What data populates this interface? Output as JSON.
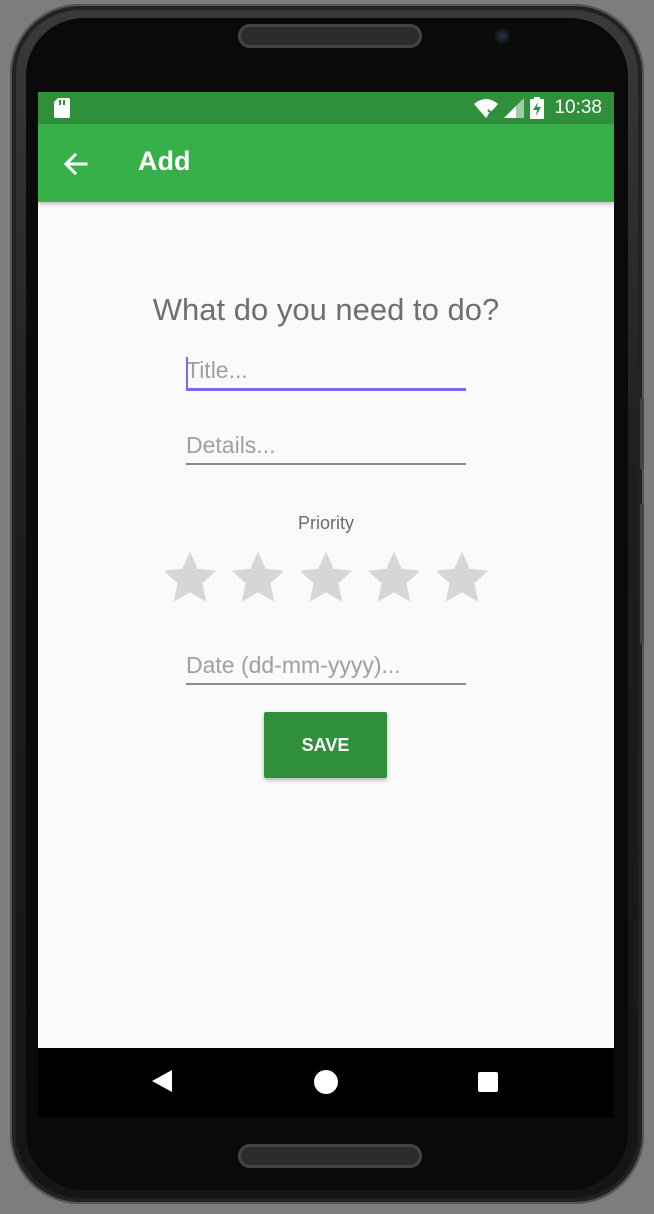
{
  "status_bar": {
    "time": "10:38",
    "icons": [
      "sd-card-icon",
      "wifi-icon",
      "signal-icon",
      "battery-charging-icon"
    ]
  },
  "app_bar": {
    "back_icon": "arrow-back-icon",
    "title": "Add",
    "color": "#37b04a"
  },
  "form": {
    "heading": "What do you need to do?",
    "title_placeholder": "Title...",
    "title_value": "",
    "details_placeholder": "Details...",
    "details_value": "",
    "priority_label": "Priority",
    "priority_stars_total": 5,
    "priority_selected": 0,
    "date_placeholder": "Date (dd-mm-yyyy)...",
    "date_value": "",
    "save_label": "SAVE",
    "accent_color": "#7b68ee",
    "button_color": "#2f8f3a"
  },
  "nav_bar": {
    "icons": [
      "nav-back-icon",
      "nav-home-icon",
      "nav-recent-apps-icon"
    ]
  }
}
